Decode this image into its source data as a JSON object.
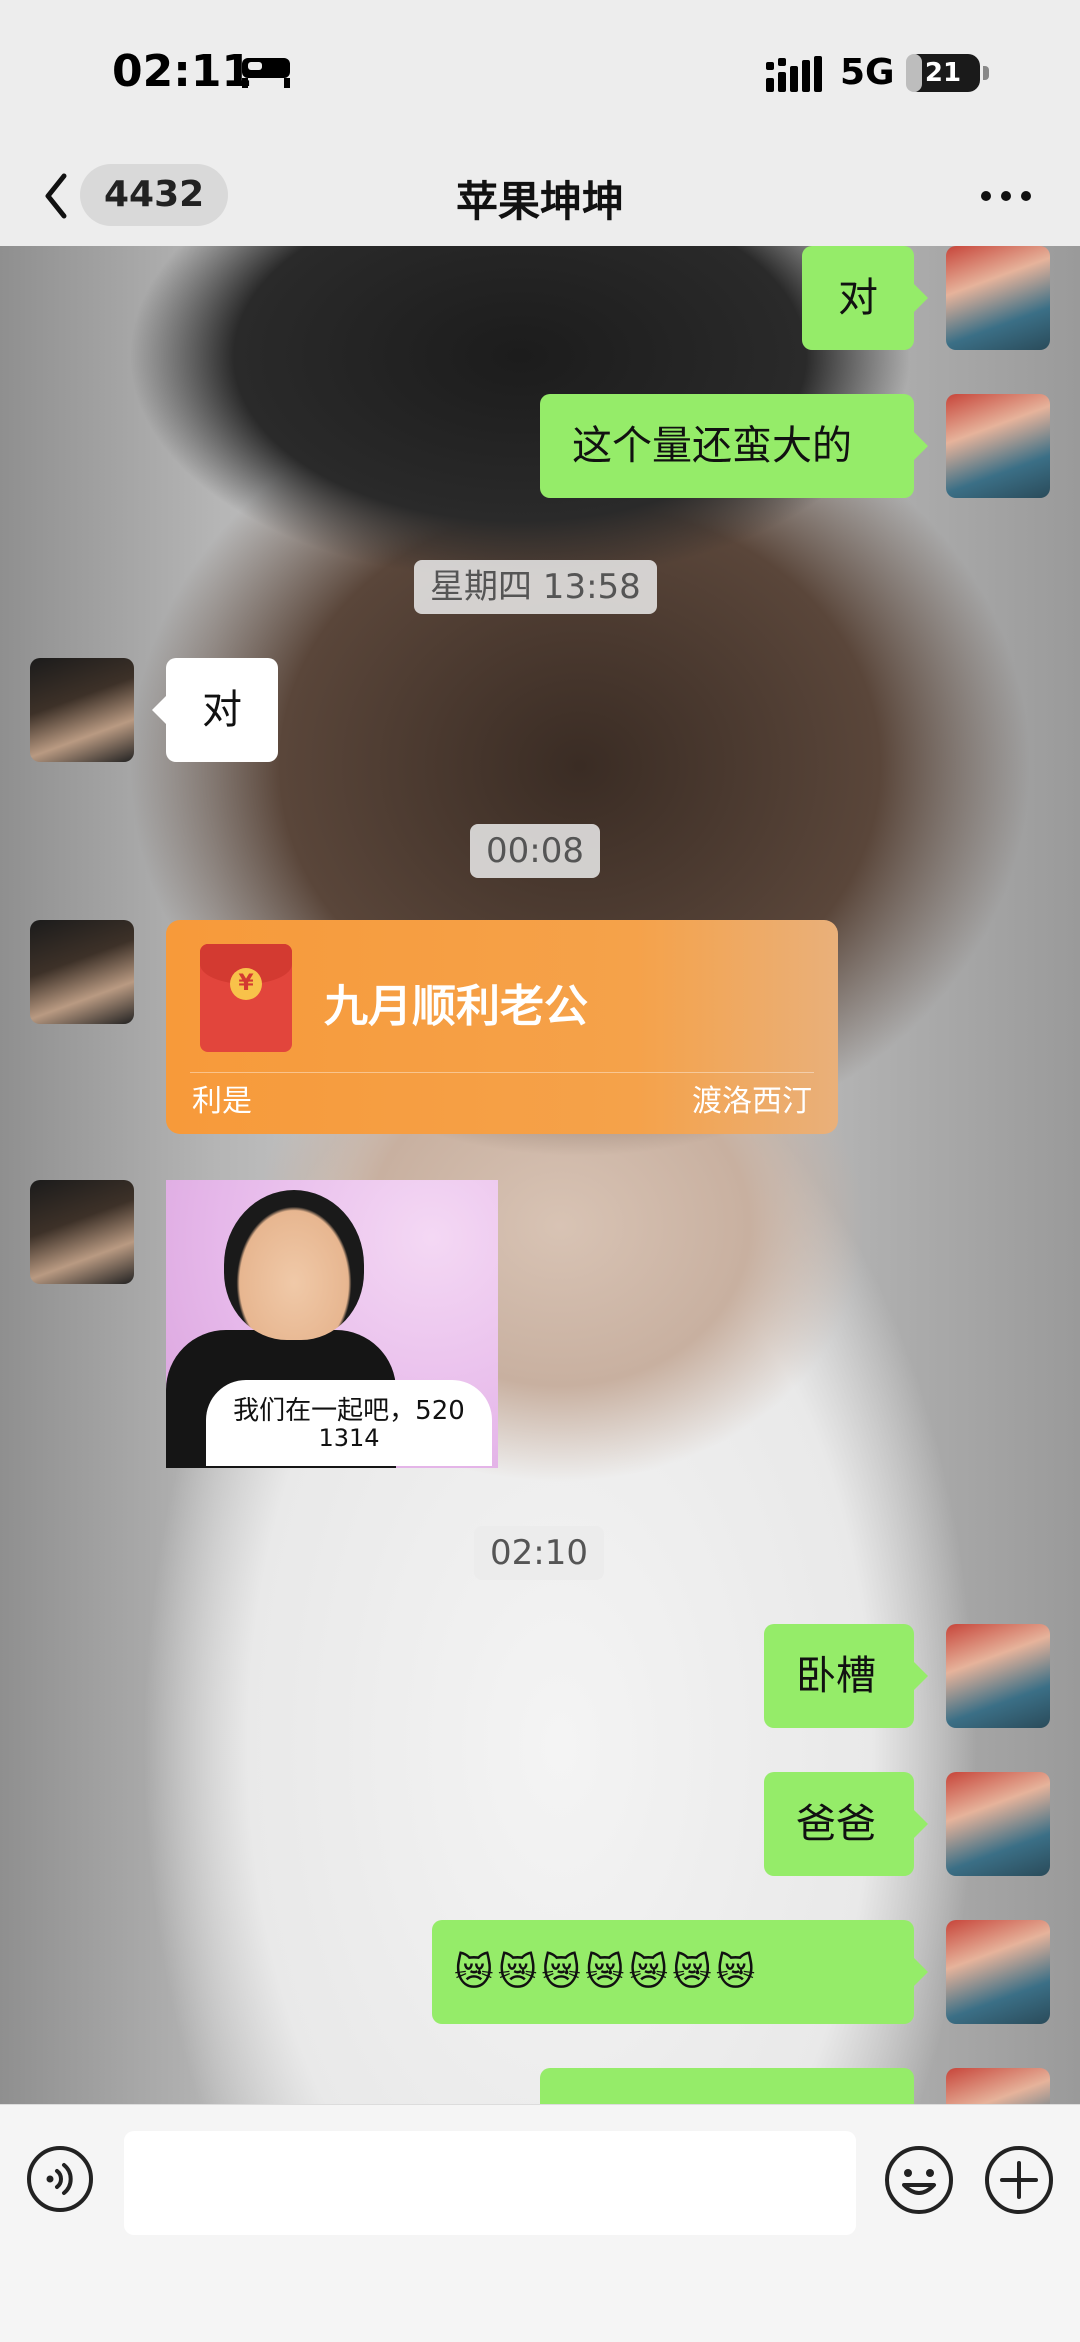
{
  "status_bar": {
    "time": "02:11",
    "network": "5G",
    "battery": "21",
    "battery_level_percent": 21,
    "icons": [
      "bed-icon",
      "signal-icon",
      "battery-icon"
    ]
  },
  "nav": {
    "back_icon": "chevron-left-icon",
    "unread_count": "4432",
    "title": "苹果坤坤",
    "more_icon": "more-dots-icon"
  },
  "messages": [
    {
      "from": "me",
      "type": "text",
      "text": "对"
    },
    {
      "from": "me",
      "type": "text",
      "text": "这个量还蛮大的"
    },
    {
      "type": "time",
      "text": "星期四 13:58"
    },
    {
      "from": "other",
      "type": "text",
      "text": "对"
    },
    {
      "type": "time",
      "text": "00:08"
    },
    {
      "from": "other",
      "type": "red_packet",
      "title": "九月顺利老公",
      "label": "利是",
      "sender": "渡洛西汀",
      "coin": "¥"
    },
    {
      "from": "other",
      "type": "sticker",
      "caption_line1": "我们在一起吧，520",
      "caption_line2": "1314"
    },
    {
      "type": "time",
      "text": "02:10"
    },
    {
      "from": "me",
      "type": "text",
      "text": "卧槽"
    },
    {
      "from": "me",
      "type": "text",
      "text": "爸爸"
    },
    {
      "from": "me",
      "type": "text",
      "text": "😿😿😿😿😿😿😿"
    }
  ],
  "input_bar": {
    "voice_icon": "voice-icon",
    "input_value": "",
    "emoji_icon": "emoji-icon",
    "plus_icon": "plus-icon"
  },
  "colors": {
    "my_bubble": "#95ec69",
    "other_bubble": "#ffffff",
    "red_packet": "#f79a3a",
    "bar_bg": "#ededed"
  }
}
